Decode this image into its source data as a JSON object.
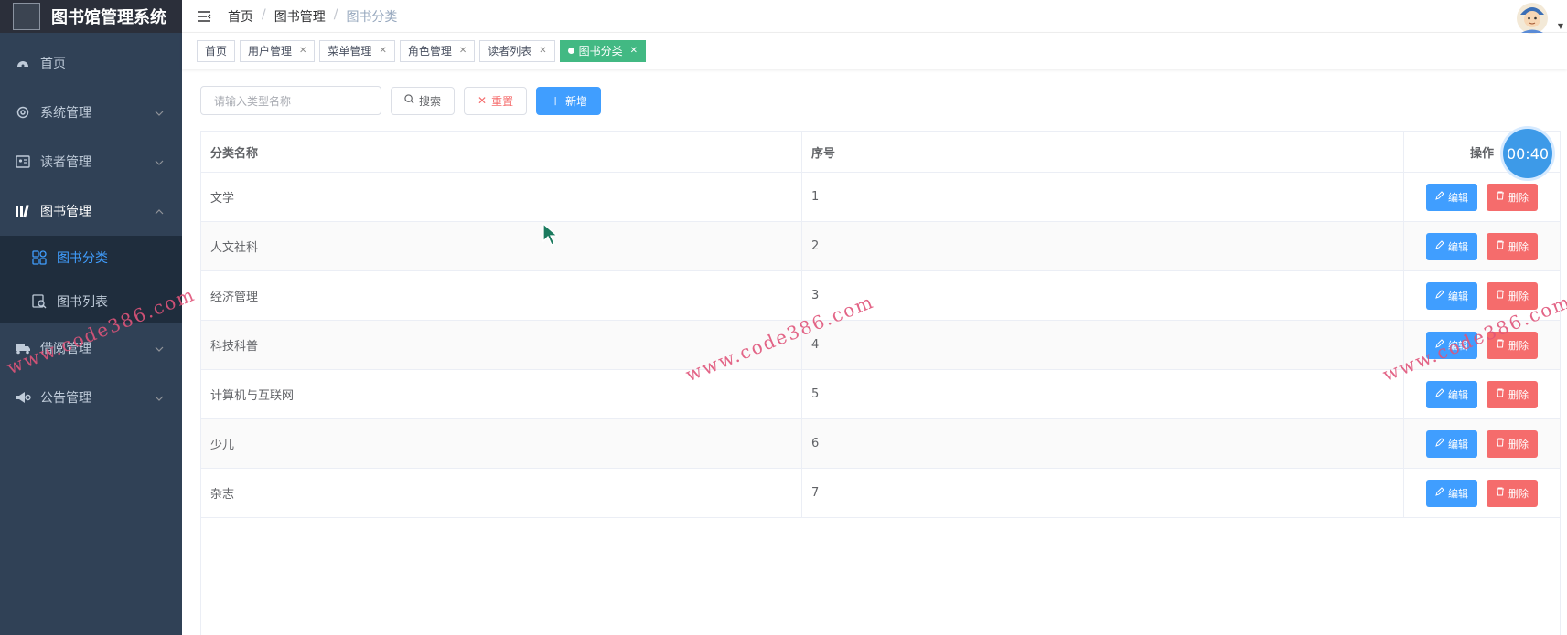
{
  "app": {
    "title": "图书馆管理系统"
  },
  "sidebar": {
    "items": [
      {
        "label": "首页",
        "icon": "dashboard-icon"
      },
      {
        "label": "系统管理",
        "icon": "gear-icon"
      },
      {
        "label": "读者管理",
        "icon": "id-card-icon"
      },
      {
        "label": "图书管理",
        "icon": "books-icon"
      },
      {
        "label": "借阅管理",
        "icon": "truck-icon"
      },
      {
        "label": "公告管理",
        "icon": "megaphone-icon"
      }
    ],
    "sub_items": [
      {
        "label": "图书分类",
        "icon": "category-icon",
        "active": true
      },
      {
        "label": "图书列表",
        "icon": "list-search-icon",
        "active": false
      }
    ]
  },
  "breadcrumb": [
    "首页",
    "图书管理",
    "图书分类"
  ],
  "tags": [
    {
      "label": "首页",
      "closable": false
    },
    {
      "label": "用户管理",
      "closable": true
    },
    {
      "label": "菜单管理",
      "closable": true
    },
    {
      "label": "角色管理",
      "closable": true
    },
    {
      "label": "读者列表",
      "closable": true
    },
    {
      "label": "图书分类",
      "closable": true,
      "active": true
    }
  ],
  "toolbar": {
    "search_placeholder": "请输入类型名称",
    "search_label": "搜索",
    "reset_label": "重置",
    "add_label": "新增"
  },
  "table": {
    "columns": [
      "分类名称",
      "序号",
      "操作"
    ],
    "rows": [
      {
        "name": "文学",
        "order": "1"
      },
      {
        "name": "人文社科",
        "order": "2"
      },
      {
        "name": "经济管理",
        "order": "3"
      },
      {
        "name": "科技科普",
        "order": "4"
      },
      {
        "name": "计算机与互联网",
        "order": "5"
      },
      {
        "name": "少儿",
        "order": "6"
      },
      {
        "name": "杂志",
        "order": "7"
      }
    ],
    "edit_label": "编辑",
    "delete_label": "删除"
  },
  "timer": "00:40",
  "watermark": "www.code386.com",
  "colors": {
    "sidebar_bg": "#304156",
    "active": "#409eff",
    "tag_active": "#42b983",
    "danger": "#f56c6c"
  }
}
